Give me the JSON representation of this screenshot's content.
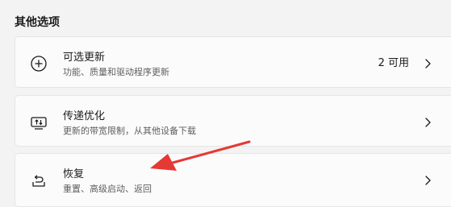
{
  "section": {
    "title": "其他选项"
  },
  "items": [
    {
      "title": "可选更新",
      "subtitle": "功能、质量和驱动程序更新",
      "right_text": "2 可用",
      "icon": "plus-circle-icon"
    },
    {
      "title": "传递优化",
      "subtitle": "更新的带宽限制，从其他设备下载",
      "icon": "delivery-optimization-icon"
    },
    {
      "title": "恢复",
      "subtitle": "重置、高级启动、返回",
      "icon": "recovery-icon"
    }
  ],
  "annotation": {
    "color": "#e53935"
  }
}
